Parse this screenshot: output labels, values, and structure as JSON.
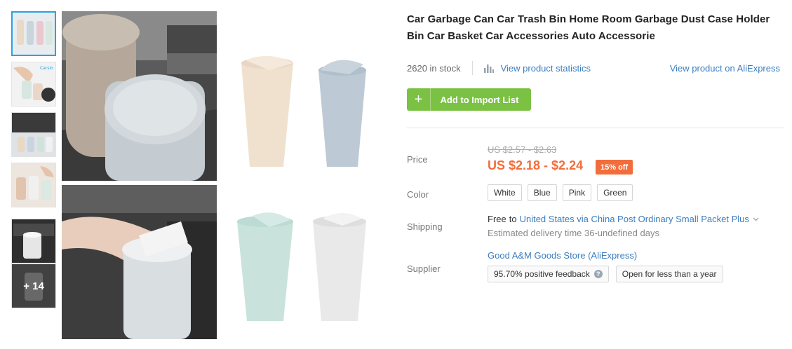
{
  "product": {
    "title": "Car Garbage Can Car Trash Bin Home Room Garbage Dust Case Holder Bin Car Basket Car Accessories Auto Accessorie",
    "stock": "2620 in stock",
    "stats_link": "View product statistics",
    "aliexpress_link": "View product on AliExpress",
    "add_button": "Add to Import List",
    "add_icon": "+"
  },
  "gallery": {
    "thumbnails": [
      {
        "name": "thumb-1"
      },
      {
        "name": "thumb-2",
        "caption": "Carsio"
      },
      {
        "name": "thumb-3"
      },
      {
        "name": "thumb-4"
      },
      {
        "name": "thumb-5"
      }
    ],
    "more_count": "+ 14"
  },
  "price": {
    "label": "Price",
    "original": "US $2.57 - $2.63",
    "current": "US $2.18 - $2.24",
    "discount": "15% off"
  },
  "color": {
    "label": "Color",
    "options": [
      "White",
      "Blue",
      "Pink",
      "Green"
    ]
  },
  "shipping": {
    "label": "Shipping",
    "free": "Free",
    "to": "to",
    "destination": "United States via China Post Ordinary Small Packet Plus",
    "estimate": "Estimated delivery time 36-undefined days"
  },
  "supplier": {
    "label": "Supplier",
    "store": "Good A&M Goods Store (AliExpress)",
    "feedback": "95.70% positive feedback",
    "help_icon": "?",
    "open_duration": "Open for less than a year"
  },
  "colors": {
    "link": "#3b7ec0",
    "accent_green": "#7bc143",
    "price_orange": "#f26d3b",
    "thumb_active": "#29a3e0"
  },
  "icons": {
    "stats": "bar-chart-icon",
    "dropdown": "chevron-down-icon",
    "plus": "plus-icon",
    "help": "help-circle-icon"
  }
}
